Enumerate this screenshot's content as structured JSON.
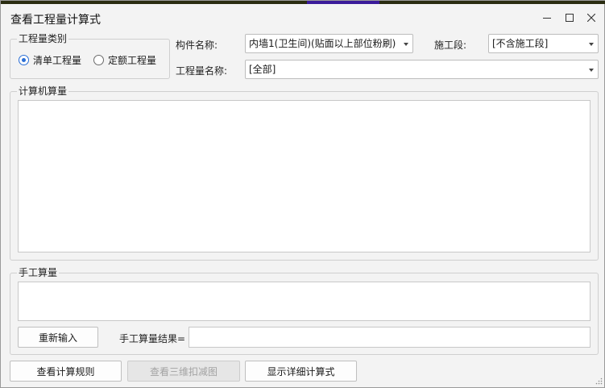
{
  "window": {
    "title": "查看工程量计算式",
    "controls": {
      "minimize_icon": "minimize-icon",
      "maximize_icon": "maximize-icon",
      "close_icon": "close-icon"
    }
  },
  "quantity_type": {
    "legend": "工程量类别",
    "options": [
      {
        "label": "清单工程量",
        "selected": true
      },
      {
        "label": "定额工程量",
        "selected": false
      }
    ]
  },
  "filters": {
    "component_name_label": "构件名称:",
    "component_name_value": "内墙1(卫生间)(贴面以上部位粉刷)",
    "construction_stage_label": "施工段:",
    "construction_stage_value": "[不含施工段]",
    "quantity_name_label": "工程量名称:",
    "quantity_name_value": "[全部]"
  },
  "computer_calc": {
    "legend": "计算机算量",
    "content": ""
  },
  "manual_calc": {
    "legend": "手工算量",
    "content": "",
    "reenter_button": "重新输入",
    "result_label": "手工算量结果=",
    "result_value": ""
  },
  "footer": {
    "view_rules_button": "查看计算规则",
    "view_3d_button": "查看三维扣减图",
    "show_detail_button": "显示详细计算式"
  },
  "colors": {
    "radio_selected": "#2b6fd6",
    "window_bg": "#f3f3f3"
  }
}
